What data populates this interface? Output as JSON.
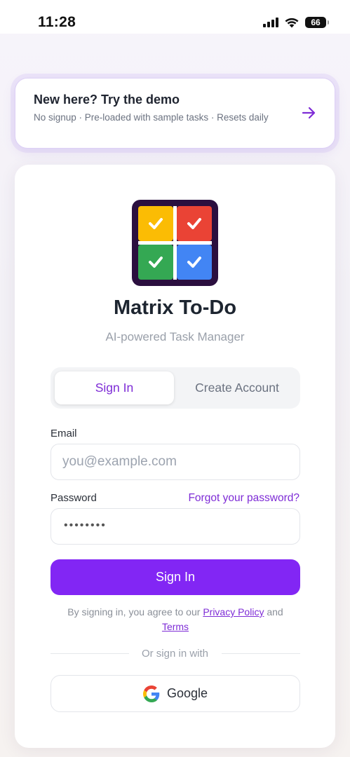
{
  "status_bar": {
    "time": "11:28",
    "battery": "66"
  },
  "demo": {
    "title": "New here? Try the demo",
    "subtitle": "No signup · Pre-loaded with sample tasks · Resets daily"
  },
  "app": {
    "title": "Matrix To-Do",
    "subtitle": "AI-powered Task Manager"
  },
  "tabs": {
    "sign_in": "Sign In",
    "create_account": "Create Account"
  },
  "form": {
    "email_label": "Email",
    "email_placeholder": "you@example.com",
    "password_label": "Password",
    "password_value": "••••••••",
    "forgot_link": "Forgot your password?",
    "submit_label": "Sign In"
  },
  "legal": {
    "prefix": "By signing in, you agree to our",
    "privacy_link": "Privacy Policy",
    "and": "and",
    "terms_link": "Terms"
  },
  "divider": {
    "text": "Or sign in with"
  },
  "social": {
    "google_label": "Google"
  },
  "colors": {
    "accent": "#8226f4",
    "link": "#7e2cd6",
    "logo_border": "#2b0f3f",
    "quadrant_yellow": "#fbbc04",
    "quadrant_red": "#ea4335",
    "quadrant_green": "#34a853",
    "quadrant_blue": "#4285f4"
  },
  "icons": {
    "demo_arrow": "arrow-right-icon",
    "logo": "matrix-grid-check-icon",
    "google": "google-g-icon"
  }
}
